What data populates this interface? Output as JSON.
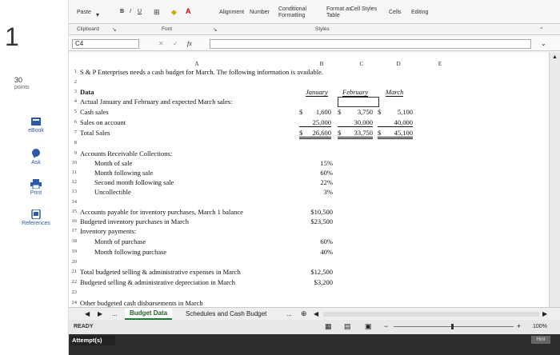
{
  "question": {
    "number": "1",
    "points_value": "30",
    "points_label": "points",
    "tools": [
      {
        "label": "eBook",
        "icon": "book-icon"
      },
      {
        "label": "Ask",
        "icon": "chat-icon"
      },
      {
        "label": "Print",
        "icon": "printer-icon"
      },
      {
        "label": "References",
        "icon": "references-icon"
      }
    ]
  },
  "ribbon": {
    "paste": "Paste",
    "bold": "B",
    "italic": "I",
    "underline": "U",
    "alignment": "Alignment",
    "number": "Number",
    "conditional_formatting": "Conditional Formatting",
    "format_as_table": "Format as Table",
    "cell_styles": "Cell Styles",
    "cells": "Cells",
    "editing": "Editing",
    "group_clipboard": "Clipboard",
    "group_font": "Font",
    "group_styles": "Styles"
  },
  "formula_bar": {
    "name_box": "C4",
    "fx": "fx",
    "cancel": "✕",
    "confirm": "✓"
  },
  "columns": [
    "A",
    "B",
    "C",
    "D",
    "E"
  ],
  "rows": {
    "r1": "S & P Enterprises needs a cash budget for March. The following information is available.",
    "r3_label": "Data",
    "r3_jan": "January",
    "r3_feb": "February",
    "r3_mar": "March",
    "r4": "Actual January and February and expected March sales:",
    "r5_label": "Cash sales",
    "r5_jan_sym": "$",
    "r5_jan": "1,600",
    "r5_feb_sym": "$",
    "r5_feb": "3,750",
    "r5_mar_sym": "$",
    "r5_mar": "5,100",
    "r6_label": "Sales on account",
    "r6_jan": "25,000",
    "r6_feb": "30,000",
    "r6_mar": "40,000",
    "r7_label": "Total Sales",
    "r7_jan_sym": "$",
    "r7_jan": "26,600",
    "r7_feb_sym": "$",
    "r7_feb": "33,750",
    "r7_mar_sym": "$",
    "r7_mar": "45,100",
    "r9": "Accounts Receivable Collections:",
    "r10_label": "Month of sale",
    "r10_val": "15%",
    "r11_label": "Month following sale",
    "r11_val": "60%",
    "r12_label": "Second month following sale",
    "r12_val": "22%",
    "r13_label": "Uncollectible",
    "r13_val": "3%",
    "r15_label": "Accounts payable for inventory purchases, March 1 balance",
    "r15_val": "$10,500",
    "r16_label": "Budgeted inventory purchases in March",
    "r16_val": "$23,500",
    "r17_label": "Inventory payments:",
    "r18_label": "Month of purchase",
    "r18_val": "60%",
    "r19_label": "Month following purchase",
    "r19_val": "40%",
    "r21_label": "Total budgeted selling & administrative expenses in March",
    "r21_val": "$12,500",
    "r22_label": "Budgeted selling & administrative depreciation in March",
    "r22_val": "$3,200",
    "r24_label": "Other budgeted cash disbursements in March"
  },
  "tabs": {
    "active": "Budget Data",
    "other": "Schedules and Cash Budget",
    "more": "..."
  },
  "status": {
    "ready": "READY",
    "zoom": "100%"
  },
  "attempt": {
    "label": "Attempt(s)",
    "hint": "Hint"
  }
}
